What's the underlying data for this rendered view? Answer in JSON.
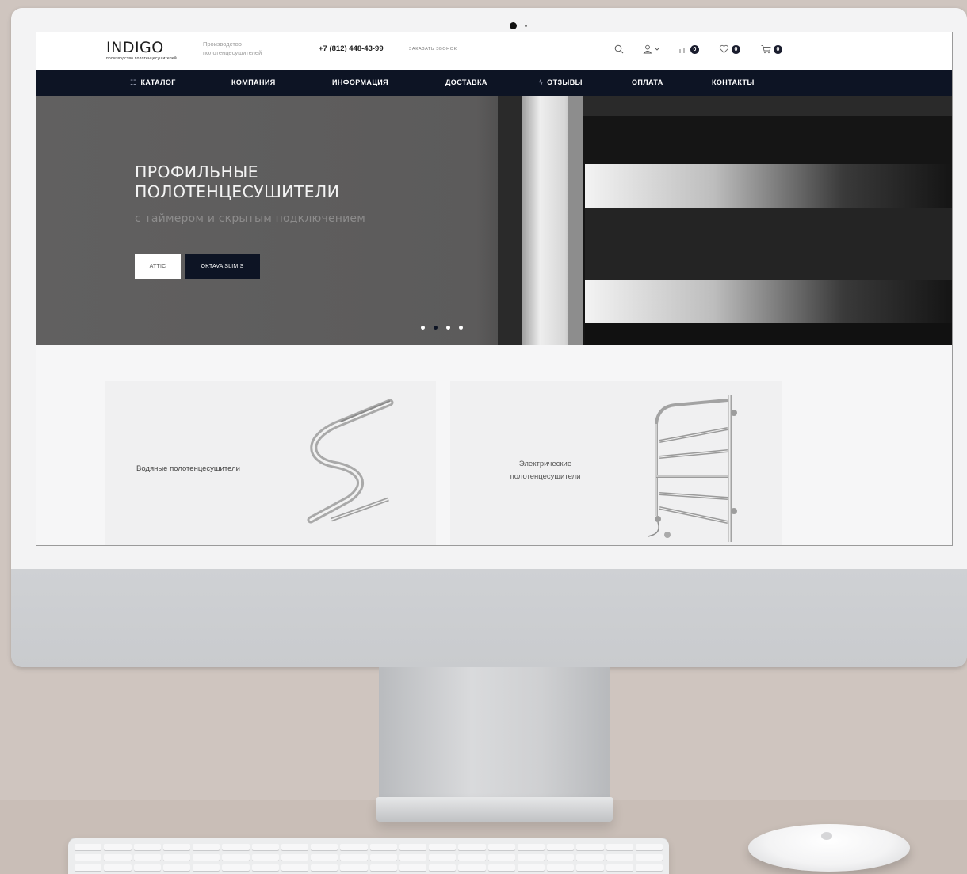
{
  "header": {
    "logo_text": "INDIGO",
    "logo_subtext": "производство полотенцесушителей",
    "tagline": "Производство полотенцесушителей",
    "phone": "+7 (812) 448-43-99",
    "callback_label": "заказать звонок",
    "compare_count": "0",
    "wishlist_count": "0",
    "cart_count": "0",
    "icons": [
      "search-icon",
      "user-icon",
      "compare-icon",
      "heart-icon",
      "cart-icon"
    ]
  },
  "nav": {
    "items": [
      {
        "label": "КАТАЛОГ",
        "icon": "grid-icon"
      },
      {
        "label": "КОМПАНИЯ"
      },
      {
        "label": "ИНФОРМАЦИЯ"
      },
      {
        "label": "ДОСТАВКА"
      },
      {
        "label": "ОТЗЫВЫ",
        "icon": "bolt-icon"
      },
      {
        "label": "ОПЛАТА"
      },
      {
        "label": "КОНТАКТЫ"
      }
    ]
  },
  "hero": {
    "title_line1": "ПРОФИЛЬНЫЕ",
    "title_line2": "ПОЛОТЕНЦЕСУШИТЕЛИ",
    "subtitle": "с таймером и скрытым подключением",
    "buttons": [
      {
        "label": "ATTIC"
      },
      {
        "label": "OKTAVA SLIM S"
      }
    ],
    "slides_total": 4,
    "active_slide": 2
  },
  "categories": [
    {
      "label": "Водяные полотенцесушители"
    },
    {
      "label": "Электрические полотенцесушители"
    }
  ],
  "colors": {
    "nav_bg": "#0d1424",
    "hero_bg": "#616060",
    "badge_bg": "#1a1d2e",
    "wall": "#cfc5bf"
  }
}
